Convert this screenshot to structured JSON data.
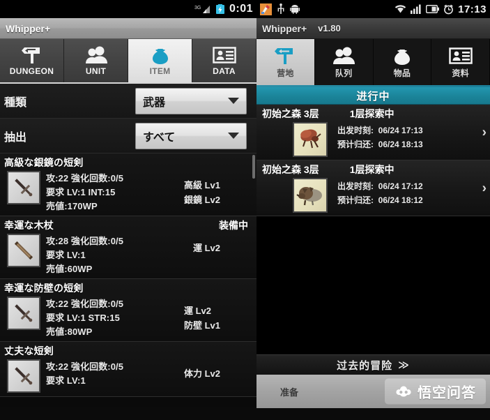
{
  "left": {
    "statusbar": {
      "network_icon": "3g-signal-icon",
      "battery_icon": "battery-charging-icon",
      "clock": "0:01"
    },
    "title": "Whipper+",
    "tabs": [
      {
        "label": "DUNGEON",
        "icon": "signpost-icon",
        "active": false
      },
      {
        "label": "UNIT",
        "icon": "people-icon",
        "active": false
      },
      {
        "label": "ITEM",
        "icon": "money-bag-icon",
        "active": true
      },
      {
        "label": "DATA",
        "icon": "id-card-icon",
        "active": false
      }
    ],
    "filters": [
      {
        "label": "種類",
        "value": "武器",
        "caret_icon": "chevron-down-icon"
      },
      {
        "label": "抽出",
        "value": "すべて",
        "caret_icon": "chevron-down-icon"
      }
    ],
    "items": [
      {
        "name": "高級な銀鏡の短剣",
        "equipped": "",
        "icon": "dagger-icon",
        "stats": [
          "攻:22 強化回数:0/5",
          "要求 LV:1 INT:15",
          "売値:170WP"
        ],
        "tags": [
          "高級 Lv1",
          "銀鏡 Lv2"
        ]
      },
      {
        "name": "幸運な木杖",
        "equipped": "装備中",
        "icon": "staff-icon",
        "stats": [
          "攻:28 強化回数:0/5",
          "要求 LV:1",
          "売値:60WP"
        ],
        "tags": [
          "運 Lv2"
        ]
      },
      {
        "name": "幸運な防壁の短剣",
        "equipped": "",
        "icon": "dagger-icon",
        "stats": [
          "攻:22 強化回数:0/5",
          "要求 LV:1 STR:15",
          "売値:80WP"
        ],
        "tags": [
          "運 Lv2",
          "防壁 Lv1"
        ]
      },
      {
        "name": "丈夫な短剣",
        "equipped": "",
        "icon": "dagger-icon",
        "stats": [
          "攻:22 強化回数:0/5",
          "要求 LV:1",
          "売値:"
        ],
        "tags": [
          "体力 Lv2"
        ]
      }
    ]
  },
  "right": {
    "statusbar": {
      "app_icon": "app-launcher-icon",
      "usb_icon": "usb-icon",
      "android_icon": "android-icon",
      "wifi_icon": "wifi-icon",
      "signal_icon": "cell-signal-icon",
      "battery_icon": "battery-icon",
      "alarm_icon": "alarm-clock-icon",
      "clock": "17:13"
    },
    "title": "Whipper+",
    "version": "v1.80",
    "tabs": [
      {
        "label": "营地",
        "icon": "signpost-icon",
        "active": true
      },
      {
        "label": "队列",
        "icon": "people-icon",
        "active": false
      },
      {
        "label": "物品",
        "icon": "money-bag-icon",
        "active": false
      },
      {
        "label": "资料",
        "icon": "id-card-icon",
        "active": false
      }
    ],
    "section_header": "进行中",
    "adventures": [
      {
        "place": "初始之森 3层",
        "state": "1层探索中",
        "thumb_icon": "red-beetle-icon",
        "depart_label": "出发时刻:",
        "depart_value": "06/24 17:13",
        "return_label": "预计归还:",
        "return_value": "06/24 18:13",
        "chevron": "›"
      },
      {
        "place": "初始之森 3层",
        "state": "1层探索中",
        "thumb_icon": "brown-boar-icon",
        "depart_label": "出发时刻:",
        "depart_value": "06/24 17:12",
        "return_label": "预计归还:",
        "return_value": "06/24 18:12",
        "chevron": "›"
      }
    ],
    "past_bar": "过去的冒险",
    "past_bar_chevron": "≫",
    "prepare_button": "准备",
    "watermark": {
      "icon": "wukong-cloud-icon",
      "text": "悟空问答"
    }
  }
}
